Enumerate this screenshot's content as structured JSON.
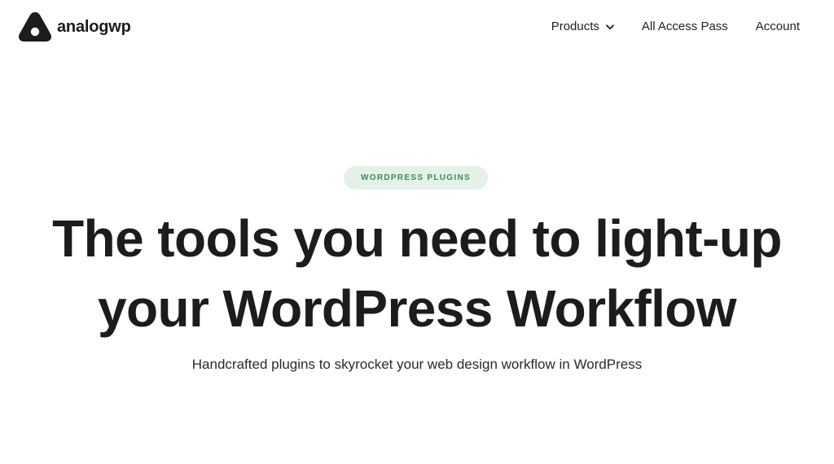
{
  "brand": {
    "name": "analogwp",
    "logo_icon": "triangle-logo-icon"
  },
  "nav": {
    "items": [
      {
        "label": "Products",
        "icon": "chevron-down-icon"
      },
      {
        "label": "All Access Pass"
      },
      {
        "label": "Account"
      }
    ]
  },
  "hero": {
    "badge": "WORDPRESS PLUGINS",
    "headline_line1": "The tools you need to light-up",
    "headline_line2": "your WordPress Workflow",
    "subtitle": "Handcrafted plugins to skyrocket your web design workflow in WordPress"
  },
  "colors": {
    "text": "#1c1c1c",
    "badge_bg": "#e3f1e8",
    "badge_text": "#3b8a59",
    "background": "#ffffff"
  }
}
